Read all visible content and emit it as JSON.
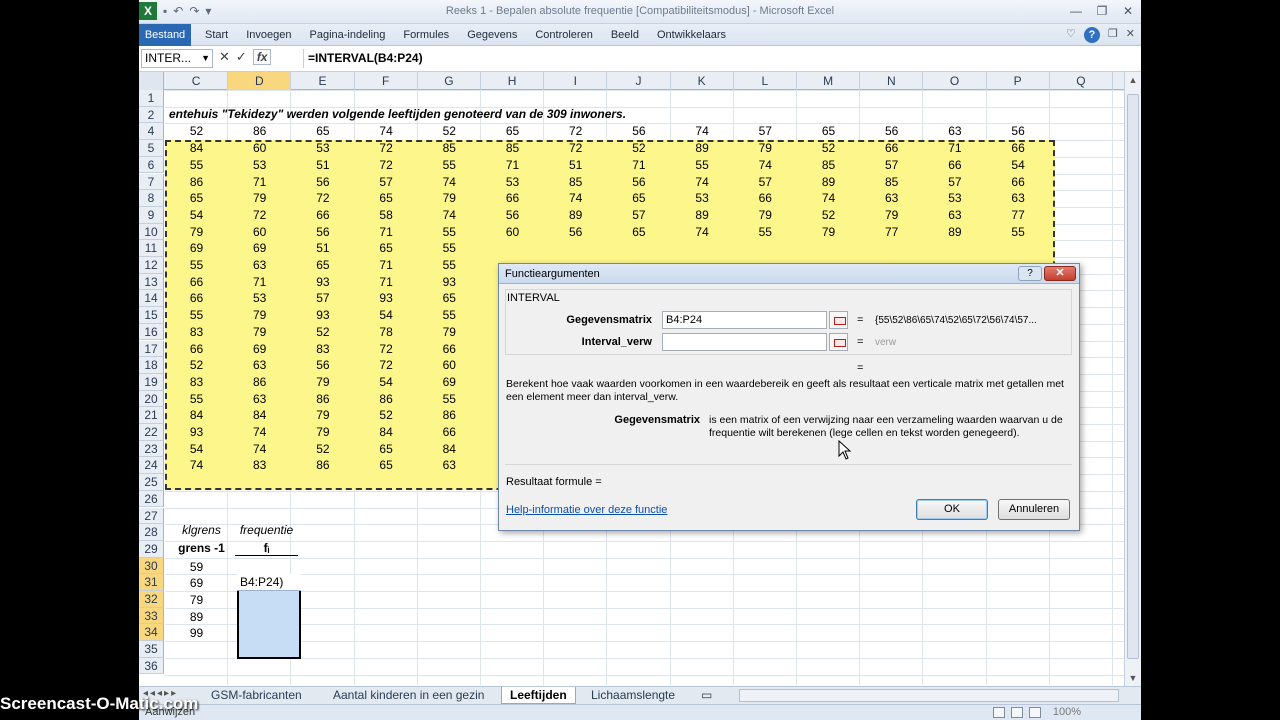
{
  "window": {
    "title": "Reeks 1 - Bepalen absolute frequentie  [Compatibiliteitsmodus]  -  Microsoft Excel",
    "app_icon": "X"
  },
  "ribbon": {
    "file_tab": "Bestand",
    "tabs": [
      "Start",
      "Invoegen",
      "Pagina-indeling",
      "Formules",
      "Gegevens",
      "Controleren",
      "Beeld",
      "Ontwikkelaars"
    ]
  },
  "formula_bar": {
    "name_box": "INTER...",
    "fx": "fx",
    "formula": "=INTERVAL(B4:P24)"
  },
  "grid": {
    "columns": [
      "C",
      "D",
      "E",
      "F",
      "G",
      "H",
      "I",
      "J",
      "K",
      "L",
      "M",
      "N",
      "O",
      "P",
      "Q"
    ],
    "rows": [
      "1",
      "2",
      "4",
      "5",
      "6",
      "7",
      "8",
      "9",
      "10",
      "11",
      "12",
      "13",
      "14",
      "15",
      "16",
      "17",
      "18",
      "19",
      "20",
      "21",
      "22",
      "23",
      "24",
      "25",
      "26",
      "27",
      "28",
      "29",
      "30",
      "31",
      "32",
      "33",
      "34",
      "35",
      "36"
    ],
    "title": "entehuis \"Tekidezy\" werden volgende leeftijden genoteerd van de 309 inwoners.",
    "data_rows": [
      [
        "52",
        "86",
        "65",
        "74",
        "52",
        "65",
        "72",
        "56",
        "74",
        "57",
        "65",
        "56",
        "63",
        "56"
      ],
      [
        "84",
        "60",
        "53",
        "72",
        "85",
        "85",
        "72",
        "52",
        "89",
        "79",
        "52",
        "66",
        "71",
        "66"
      ],
      [
        "55",
        "53",
        "51",
        "72",
        "55",
        "71",
        "51",
        "71",
        "55",
        "74",
        "85",
        "57",
        "66",
        "54"
      ],
      [
        "86",
        "71",
        "56",
        "57",
        "74",
        "53",
        "85",
        "56",
        "74",
        "57",
        "89",
        "85",
        "57",
        "66"
      ],
      [
        "65",
        "79",
        "72",
        "65",
        "79",
        "66",
        "74",
        "65",
        "53",
        "66",
        "74",
        "63",
        "53",
        "63"
      ],
      [
        "54",
        "72",
        "66",
        "58",
        "74",
        "56",
        "89",
        "57",
        "89",
        "79",
        "52",
        "79",
        "63",
        "77"
      ],
      [
        "79",
        "60",
        "56",
        "71",
        "55",
        "60",
        "56",
        "65",
        "74",
        "55",
        "79",
        "77",
        "89",
        "55"
      ],
      [
        "69",
        "69",
        "51",
        "65",
        "55"
      ],
      [
        "55",
        "63",
        "65",
        "71",
        "55"
      ],
      [
        "66",
        "71",
        "93",
        "71",
        "93"
      ],
      [
        "66",
        "53",
        "57",
        "93",
        "65"
      ],
      [
        "55",
        "79",
        "93",
        "54",
        "55"
      ],
      [
        "83",
        "79",
        "52",
        "78",
        "79"
      ],
      [
        "66",
        "69",
        "83",
        "72",
        "66"
      ],
      [
        "52",
        "63",
        "56",
        "72",
        "60"
      ],
      [
        "83",
        "86",
        "79",
        "54",
        "69"
      ],
      [
        "55",
        "63",
        "86",
        "86",
        "55"
      ],
      [
        "84",
        "84",
        "79",
        "52",
        "86"
      ],
      [
        "93",
        "74",
        "79",
        "84",
        "66"
      ],
      [
        "54",
        "74",
        "52",
        "65",
        "84"
      ],
      [
        "74",
        "83",
        "86",
        "65",
        "63"
      ]
    ],
    "klgrens_header": "klgrens",
    "freq_header": "frequentie",
    "grens_label": "grens -1",
    "fi_label": "fᵢ",
    "grens_values": [
      "59",
      "69",
      "79",
      "89",
      "99"
    ],
    "active_cell_text": "B4:P24)"
  },
  "sheet_tabs": [
    "GSM-fabricanten",
    "Aantal kinderen in een gezin",
    "Leeftijden",
    "Lichaamslengte"
  ],
  "active_sheet": "Leeftijden",
  "status": {
    "mode": "Aanwijzen",
    "zoom": "100%"
  },
  "watermark": "Screencast-O-Matic.com",
  "dialog": {
    "title": "Functieargumenten",
    "function_name": "INTERVAL",
    "args": [
      {
        "label": "Gegevensmatrix",
        "value": "B4:P24",
        "result": "{55\\52\\86\\65\\74\\52\\65\\72\\56\\74\\57..."
      },
      {
        "label": "Interval_verw",
        "value": "",
        "result": "verw"
      }
    ],
    "eq": "=",
    "description": "Berekent hoe vaak waarden voorkomen in een waardebereik en geeft als resultaat een verticale matrix met getallen met een element meer dan interval_verw.",
    "param_name": "Gegevensmatrix",
    "param_desc": "is een matrix of een verwijzing naar een verzameling waarden waarvan u de frequentie wilt berekenen (lege cellen en tekst worden genegeerd).",
    "result_label": "Resultaat formule =",
    "help_link": "Help-informatie over deze functie",
    "ok": "OK",
    "cancel": "Annuleren"
  }
}
